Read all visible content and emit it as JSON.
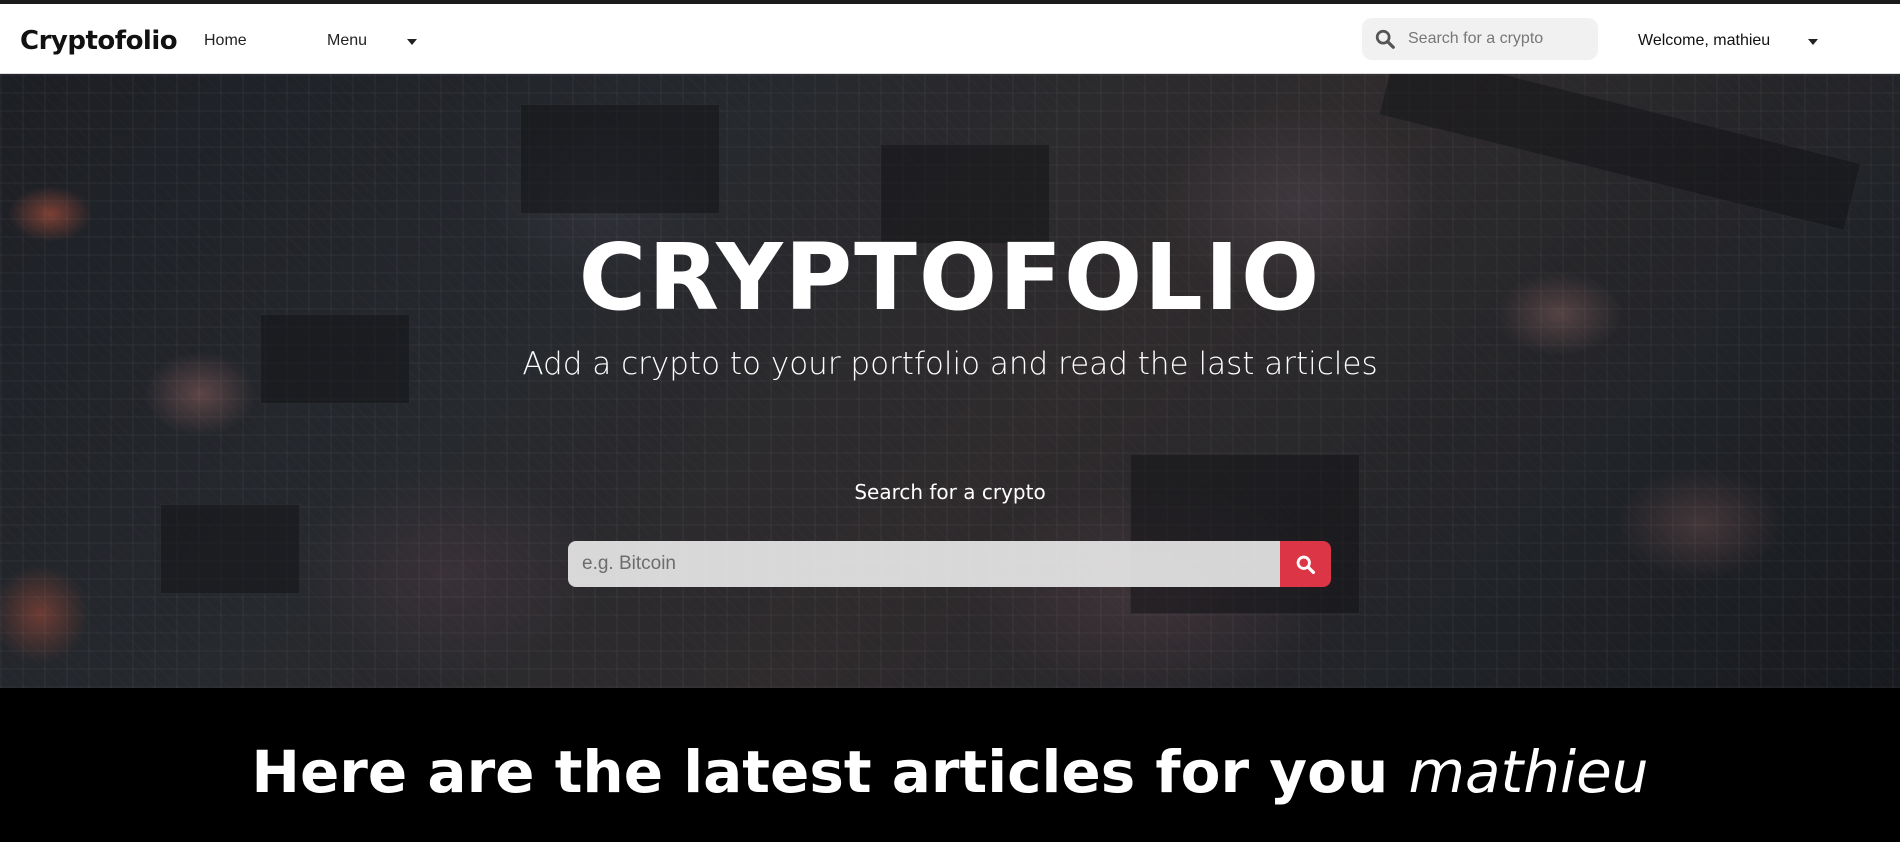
{
  "navbar": {
    "brand": "Cryptofolio",
    "home_label": "Home",
    "menu_label": "Menu",
    "search_placeholder": "Search for a crypto",
    "welcome_label": "Welcome, mathieu",
    "search_icon": "search-icon",
    "caret_icon": "caret-down-icon"
  },
  "hero": {
    "title": "CRYPTOFOLIO",
    "subtitle": "Add a crypto to your portfolio and read the last articles",
    "search_label": "Search for a crypto",
    "search_placeholder": "e.g. Bitcoin",
    "search_button_icon": "search-icon",
    "accent_color": "#dc3545"
  },
  "articles": {
    "heading": "Here are the latest articles for you",
    "username": "mathieu"
  }
}
